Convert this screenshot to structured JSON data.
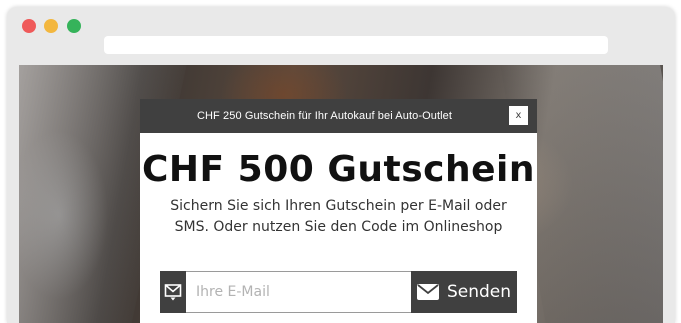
{
  "window": {
    "controls": [
      "close-dot",
      "minimize-dot",
      "maximize-dot"
    ],
    "colors": {
      "red": "#ef5a5a",
      "yellow": "#f3b73f",
      "green": "#35b35a"
    }
  },
  "popup": {
    "header_text": "CHF 250 Gutschein für Ihr Autokauf bei Auto-Outlet",
    "close_label": "x",
    "title": "CHF 500 Gutschein",
    "subtitle_line1": "Sichern Sie sich Ihren Gutschein per E-Mail oder",
    "subtitle_line2": "SMS. Oder nutzen Sie den Code im Onlineshop",
    "email_placeholder": "Ihre E-Mail",
    "send_label": "Senden",
    "icons": {
      "field": "mail-icon",
      "button": "envelope-icon"
    },
    "colors": {
      "dark": "#404040",
      "background": "#ffffff"
    }
  }
}
